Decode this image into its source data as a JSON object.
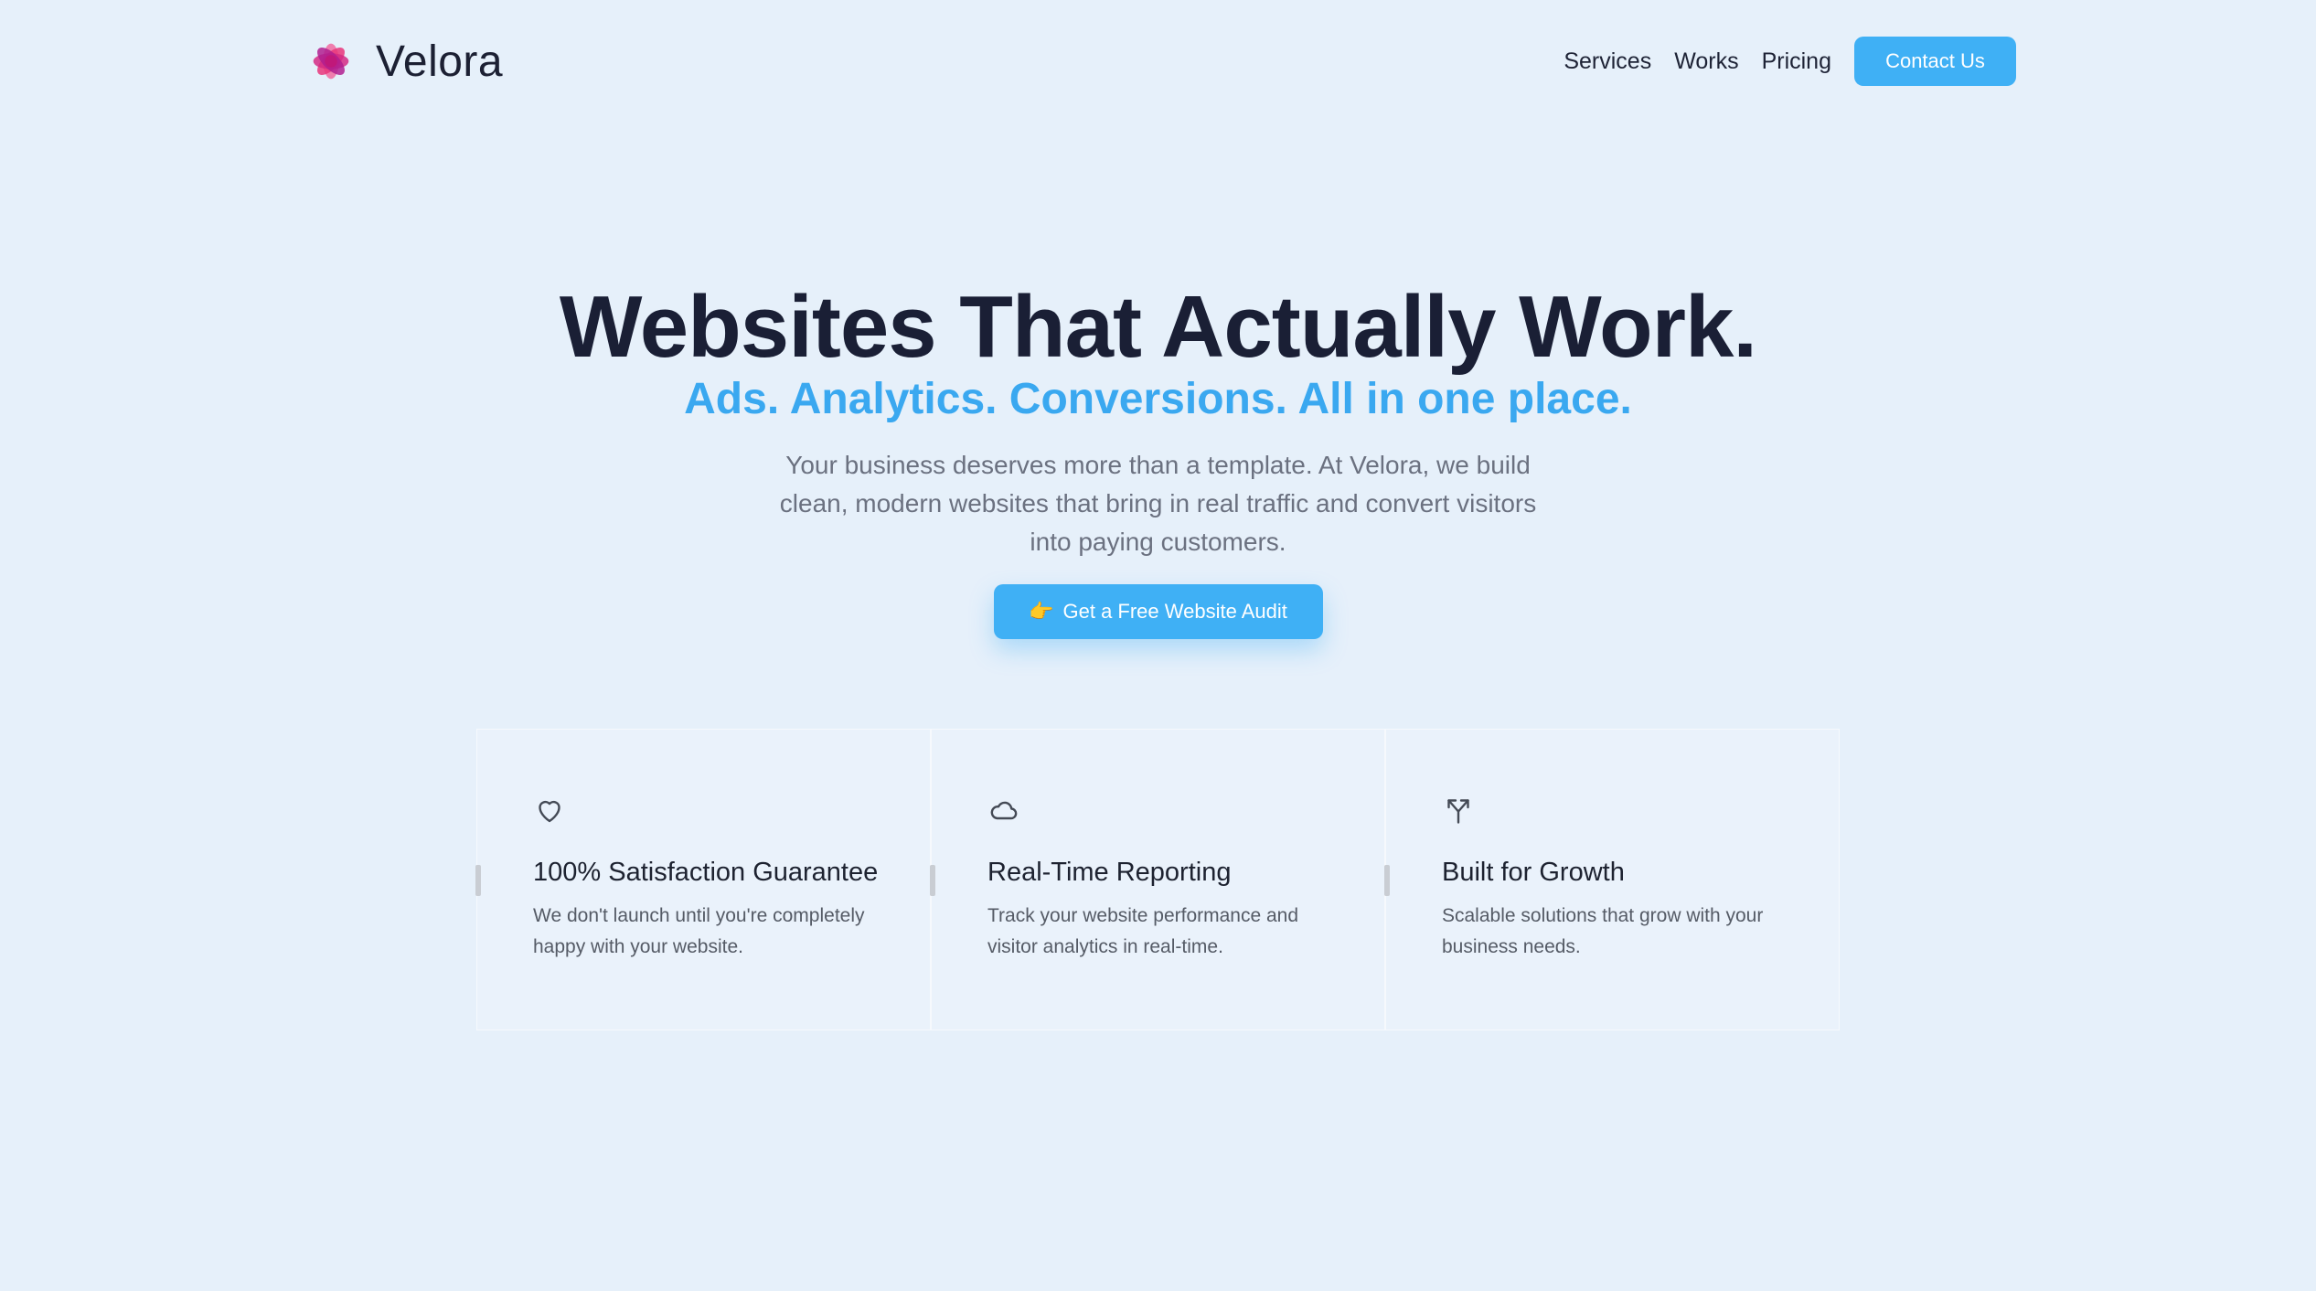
{
  "brand": {
    "name": "Velora",
    "logo_icon": "flower-logo-icon",
    "logo_colors": [
      "#e8357a",
      "#b01e8f",
      "#f06aa0"
    ]
  },
  "nav": {
    "links": [
      "Services",
      "Works",
      "Pricing"
    ],
    "contact_label": "Contact Us"
  },
  "hero": {
    "title": "Websites That Actually Work.",
    "subtitle": "Ads. Analytics. Conversions. All in one place.",
    "description": "Your business deserves more than a template. At Velora, we build clean, modern websites that bring in real traffic and convert visitors into paying customers.",
    "cta_emoji": "👉",
    "cta_label": "Get a Free Website Audit"
  },
  "features": [
    {
      "icon": "heart-icon",
      "title": "100% Satisfaction Guarantee",
      "desc": "We don't launch until you're completely happy with your website."
    },
    {
      "icon": "cloud-icon",
      "title": "Real-Time Reporting",
      "desc": "Track your website performance and visitor analytics in real-time."
    },
    {
      "icon": "branch-arrow-icon",
      "title": "Built for Growth",
      "desc": "Scalable solutions that grow with your business needs."
    }
  ],
  "colors": {
    "accent": "#3fb0f5",
    "subtitle": "#3aa8f0",
    "background": "#e6f0fa",
    "heading": "#1a1f35"
  }
}
